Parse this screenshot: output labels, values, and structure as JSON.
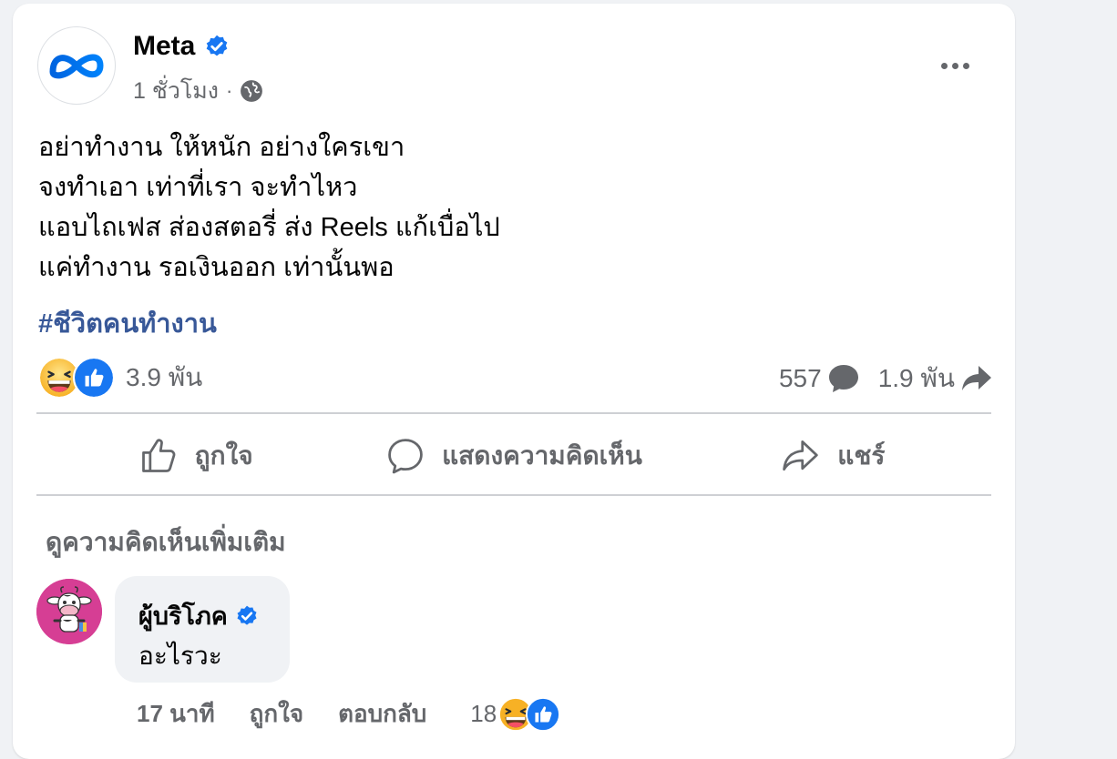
{
  "post": {
    "page_name": "Meta",
    "time": "1 ชั่วโมง",
    "separator": "·",
    "icons": {
      "avatar": "meta-logo",
      "verified": "verified-badge-icon",
      "audience": "globe-icon",
      "more": "more-options-icon"
    },
    "lines": [
      "อย่าทำงาน ให้หนัก อย่างใครเขา",
      "จงทำเอา เท่าที่เรา จะทำไหว",
      "แอบไถเฟส ส่องสตอรี่ ส่ง Reels แก้เบื่อไป",
      "แค่ทำงาน รอเงินออก เท่านั้นพอ"
    ],
    "hashtag": "#ชีวิตคนทำงาน"
  },
  "stats": {
    "reaction_count": "3.9 พัน",
    "comment_count": "557",
    "share_count": "1.9 พัน"
  },
  "actions": {
    "like_label": "ถูกใจ",
    "comment_label": "แสดงความคิดเห็น",
    "share_label": "แชร์"
  },
  "comments": {
    "more_label": "ดูความคิดเห็นเพิ่มเติม",
    "items": [
      {
        "author": "ผู้บริโภค",
        "text": "อะไรวะ",
        "time": "17 นาที",
        "like_label": "ถูกใจ",
        "reply_label": "ตอบกลับ",
        "reaction_count": "18"
      }
    ]
  },
  "colors": {
    "accent": "#1877f2",
    "hashtag": "#385898",
    "secondary_text": "#65676b",
    "background": "#f0f2f5",
    "comment_avatar": "#d63e94"
  }
}
